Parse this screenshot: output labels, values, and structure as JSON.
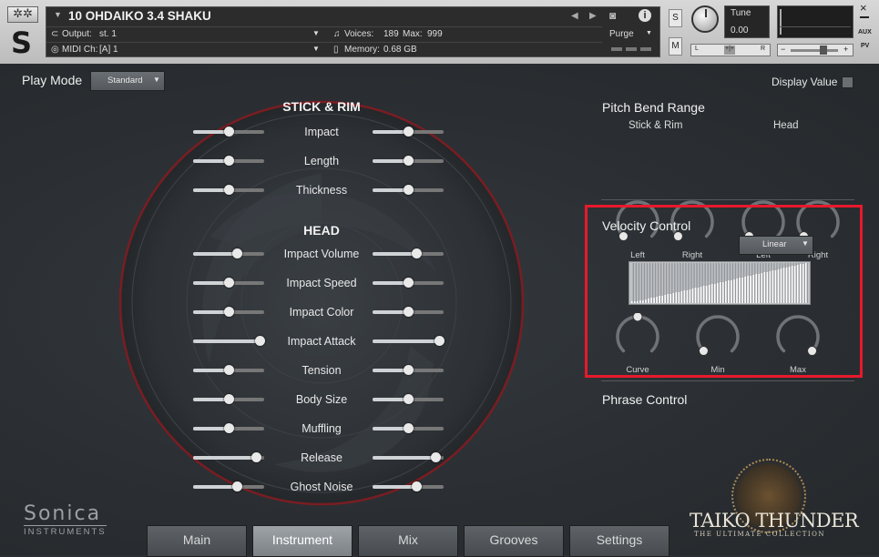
{
  "header": {
    "instrument_name": "10 OHDAIKO 3.4 SHAKU",
    "output_label": "Output:",
    "output_value": "st. 1",
    "midi_label": "MIDI Ch:",
    "midi_value": "[A]  1",
    "voices_label": "Voices:",
    "voices_value": "189",
    "max_label": "Max:",
    "max_value": "999",
    "memory_label": "Memory:",
    "memory_value": "0.68 GB",
    "purge_label": "Purge",
    "tune_label": "Tune",
    "tune_value": "0.00",
    "s_label": "S",
    "m_label": "M",
    "l_label": "L",
    "r_label": "R",
    "aux_label": "AUX",
    "pv_label": "PV",
    "close_label": "×",
    "minus_label": "−",
    "plus_label": "+",
    "logo_letter": "S"
  },
  "play_mode": {
    "label": "Play Mode",
    "value": "Standard"
  },
  "display_value": {
    "label": "Display Value"
  },
  "stick_rim": {
    "title": "STICK & RIM",
    "rows": [
      {
        "label": "Impact",
        "left": 0.5,
        "right": 0.5
      },
      {
        "label": "Length",
        "left": 0.5,
        "right": 0.5
      },
      {
        "label": "Thickness",
        "left": 0.5,
        "right": 0.5
      }
    ]
  },
  "head": {
    "title": "HEAD",
    "rows": [
      {
        "label": "Impact Volume",
        "left": 0.62,
        "right": 0.62
      },
      {
        "label": "Impact Speed",
        "left": 0.5,
        "right": 0.5
      },
      {
        "label": "Impact Color",
        "left": 0.5,
        "right": 0.5
      },
      {
        "label": "Impact Attack",
        "left": 0.94,
        "right": 0.94
      },
      {
        "label": "Tension",
        "left": 0.5,
        "right": 0.5
      },
      {
        "label": "Body Size",
        "left": 0.5,
        "right": 0.5
      },
      {
        "label": "Muffling",
        "left": 0.5,
        "right": 0.5
      },
      {
        "label": "Release",
        "left": 0.88,
        "right": 0.88
      },
      {
        "label": "Ghost Noise",
        "left": 0.62,
        "right": 0.62
      }
    ]
  },
  "pitch_bend": {
    "title": "Pitch Bend Range",
    "group1": "Stick & Rim",
    "group2": "Head",
    "left_label": "Left",
    "right_label": "Right"
  },
  "velocity": {
    "title": "Velocity Control",
    "curve_type": "Linear",
    "knob_curve": "Curve",
    "knob_min": "Min",
    "knob_max": "Max"
  },
  "phrase": {
    "title": "Phrase Control"
  },
  "tabs": [
    "Main",
    "Instrument",
    "Mix",
    "Grooves",
    "Settings"
  ],
  "active_tab": "Instrument",
  "branding": {
    "sonica_top": "Sonica",
    "sonica_bottom": "INSTRUMENTS",
    "product": "TAIKO THUNDER",
    "tagline": "THE ULTIMATE COLLECTION"
  },
  "colors": {
    "highlight_box": "#e8192c",
    "drum_ring": "#7a1d22"
  }
}
